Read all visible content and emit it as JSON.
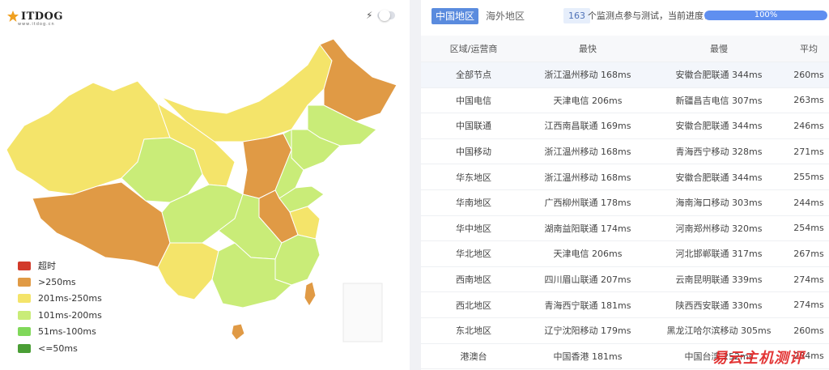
{
  "logo": {
    "text": "ITDOG",
    "sub": "www.itdog.cn"
  },
  "toggle": {
    "icon": "bolt-icon",
    "state": "off"
  },
  "colors": {
    "timeout": "#d23a2a",
    "gt250": "#e09a45",
    "r201_250": "#f4e46a",
    "r101_200": "#c9ec78",
    "r51_100": "#80d85a",
    "le50": "#4a9e35",
    "accent": "#5a8bde"
  },
  "legend": [
    {
      "label": "超时",
      "color": "#d23a2a"
    },
    {
      "label": ">250ms",
      "color": "#e09a45"
    },
    {
      "label": "201ms-250ms",
      "color": "#f4e46a"
    },
    {
      "label": "101ms-200ms",
      "color": "#c9ec78"
    },
    {
      "label": "51ms-100ms",
      "color": "#80d85a"
    },
    {
      "label": "<=50ms",
      "color": "#4a9e35"
    }
  ],
  "tabs": {
    "china": "中国地区",
    "overseas": "海外地区"
  },
  "progress": {
    "count": "163",
    "text": "个监测点参与测试，当前进度：",
    "percent_label": "100%",
    "value": 1.0
  },
  "table": {
    "headers": [
      "区域/运营商",
      "最快",
      "最慢",
      "平均"
    ],
    "rows": [
      [
        "全部节点",
        "浙江温州移动 168ms",
        "安徽合肥联通 344ms",
        "260ms"
      ],
      [
        "中国电信",
        "天津电信 206ms",
        "新疆昌吉电信 307ms",
        "263ms"
      ],
      [
        "中国联通",
        "江西南昌联通 169ms",
        "安徽合肥联通 344ms",
        "246ms"
      ],
      [
        "中国移动",
        "浙江温州移动 168ms",
        "青海西宁移动 328ms",
        "271ms"
      ],
      [
        "华东地区",
        "浙江温州移动 168ms",
        "安徽合肥联通 344ms",
        "255ms"
      ],
      [
        "华南地区",
        "广西柳州联通 178ms",
        "海南海口移动 303ms",
        "244ms"
      ],
      [
        "华中地区",
        "湖南益阳联通 174ms",
        "河南郑州移动 320ms",
        "254ms"
      ],
      [
        "华北地区",
        "天津电信 206ms",
        "河北邯郸联通 317ms",
        "267ms"
      ],
      [
        "西南地区",
        "四川眉山联通 207ms",
        "云南昆明联通 339ms",
        "274ms"
      ],
      [
        "西北地区",
        "青海西宁联通 181ms",
        "陕西西安联通 330ms",
        "274ms"
      ],
      [
        "东北地区",
        "辽宁沈阳移动 179ms",
        "黑龙江哈尔滨移动 305ms",
        "260ms"
      ],
      [
        "港澳台",
        "中国香港 181ms",
        "中国台湾 252ms",
        "284ms"
      ]
    ]
  },
  "watermark": "易云主机测评"
}
